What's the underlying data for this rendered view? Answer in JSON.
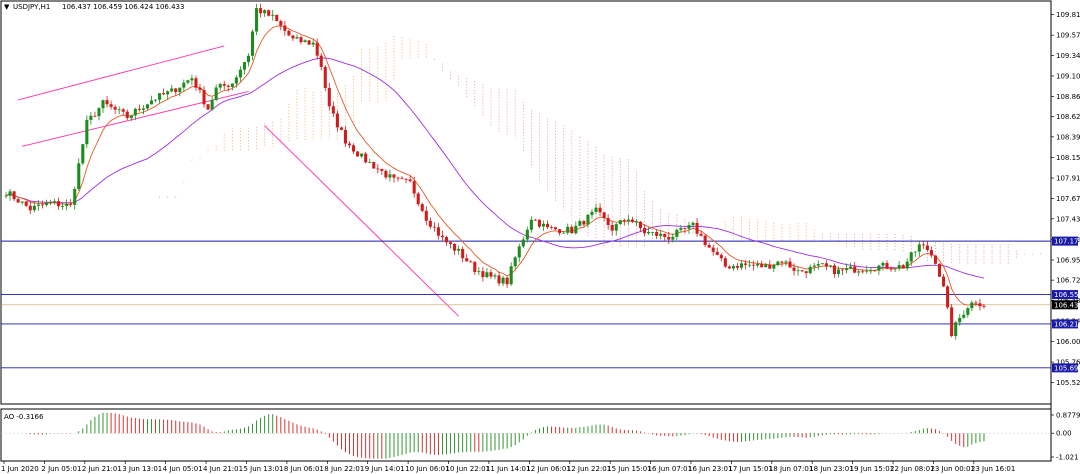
{
  "header": {
    "menu_arrow": "▼",
    "symbol_label": "USDJPY,H1",
    "ohlc": "106.437 106.459 106.424 106.433"
  },
  "ao_panel": {
    "label": "AO -0.3166",
    "ticks": [
      "0.8779",
      "0.00",
      "-1.021"
    ]
  },
  "chart_data": {
    "type": "candlestick",
    "symbol": "USDJPY",
    "timeframe": "H1",
    "ylim": [
      105.3,
      109.95
    ],
    "y_ticks": [
      "109.815",
      "109.575",
      "109.340",
      "109.100",
      "108.860",
      "108.625",
      "108.390",
      "108.150",
      "107.910",
      "107.670",
      "107.435",
      "107.195",
      "106.955",
      "106.720",
      "106.485",
      "106.245",
      "106.005",
      "105.765",
      "105.525"
    ],
    "x_ticks": [
      "1 Jun 2020",
      "2 Jun 05:01",
      "2 Jun 21:01",
      "3 Jun 13:01",
      "4 Jun 05:01",
      "4 Jun 21:01",
      "5 Jun 13:01",
      "8 Jun 06:01",
      "8 Jun 22:01",
      "9 Jun 14:01",
      "10 Jun 06:01",
      "10 Jun 22:01",
      "11 Jun 14:01",
      "12 Jun 06:01",
      "12 Jun 22:01",
      "15 Jun 15:01",
      "16 Jun 07:01",
      "16 Jun 23:01",
      "17 Jun 15:01",
      "18 Jun 07:01",
      "18 Jun 23:01",
      "19 Jun 15:01",
      "22 Jun 08:01",
      "23 Jun 00:01",
      "23 Jun 16:01"
    ],
    "price_path": [
      [
        0,
        107.75
      ],
      [
        6,
        107.55
      ],
      [
        11,
        107.62
      ],
      [
        16,
        107.58
      ],
      [
        20,
        108.55
      ],
      [
        24,
        108.78
      ],
      [
        30,
        108.62
      ],
      [
        36,
        108.82
      ],
      [
        41,
        108.92
      ],
      [
        46,
        109.08
      ],
      [
        50,
        108.72
      ],
      [
        52,
        108.95
      ],
      [
        56,
        109.02
      ],
      [
        60,
        109.35
      ],
      [
        62,
        109.88
      ],
      [
        66,
        109.78
      ],
      [
        71,
        109.52
      ],
      [
        76,
        109.48
      ],
      [
        78,
        109.22
      ],
      [
        80,
        108.72
      ],
      [
        84,
        108.35
      ],
      [
        88,
        108.15
      ],
      [
        92,
        108.02
      ],
      [
        96,
        107.88
      ],
      [
        100,
        107.85
      ],
      [
        104,
        107.45
      ],
      [
        108,
        107.2
      ],
      [
        112,
        107.05
      ],
      [
        116,
        106.85
      ],
      [
        120,
        106.75
      ],
      [
        124,
        106.7
      ],
      [
        126,
        106.98
      ],
      [
        130,
        107.45
      ],
      [
        134,
        107.32
      ],
      [
        140,
        107.3
      ],
      [
        146,
        107.52
      ],
      [
        150,
        107.32
      ],
      [
        154,
        107.45
      ],
      [
        158,
        107.28
      ],
      [
        164,
        107.22
      ],
      [
        170,
        107.35
      ],
      [
        174,
        107.1
      ],
      [
        178,
        106.88
      ],
      [
        182,
        106.9
      ],
      [
        188,
        106.88
      ],
      [
        192,
        106.95
      ],
      [
        196,
        106.82
      ],
      [
        202,
        106.88
      ],
      [
        206,
        106.82
      ],
      [
        210,
        106.85
      ],
      [
        216,
        106.88
      ],
      [
        222,
        106.88
      ],
      [
        226,
        107.12
      ],
      [
        228,
        107.08
      ],
      [
        230,
        106.95
      ],
      [
        232,
        106.62
      ],
      [
        234,
        106.1
      ],
      [
        236,
        106.28
      ],
      [
        238,
        106.42
      ],
      [
        240,
        106.48
      ],
      [
        242,
        106.43
      ]
    ],
    "levels": [
      {
        "value": "107.175",
        "color": "#1a1aa8"
      },
      {
        "value": "106.552",
        "color": "#1a1aa8"
      },
      {
        "value": "106.433",
        "color": "#000000"
      },
      {
        "value": "106.210",
        "color": "#1a1aa8"
      },
      {
        "value": "105.698",
        "color": "#1a1aa8"
      }
    ],
    "ao_ylim": [
      -1.1,
      0.95
    ],
    "colors": {
      "bull": "#1c8c1c",
      "bear": "#d21c1c",
      "ma_fast": "#e35a28",
      "ma_slow": "#a02ee0",
      "cloud": "#f0a060",
      "cloud2": "#d88aa0",
      "channel": "#ff33aa",
      "level": "#1a1aa8"
    }
  }
}
